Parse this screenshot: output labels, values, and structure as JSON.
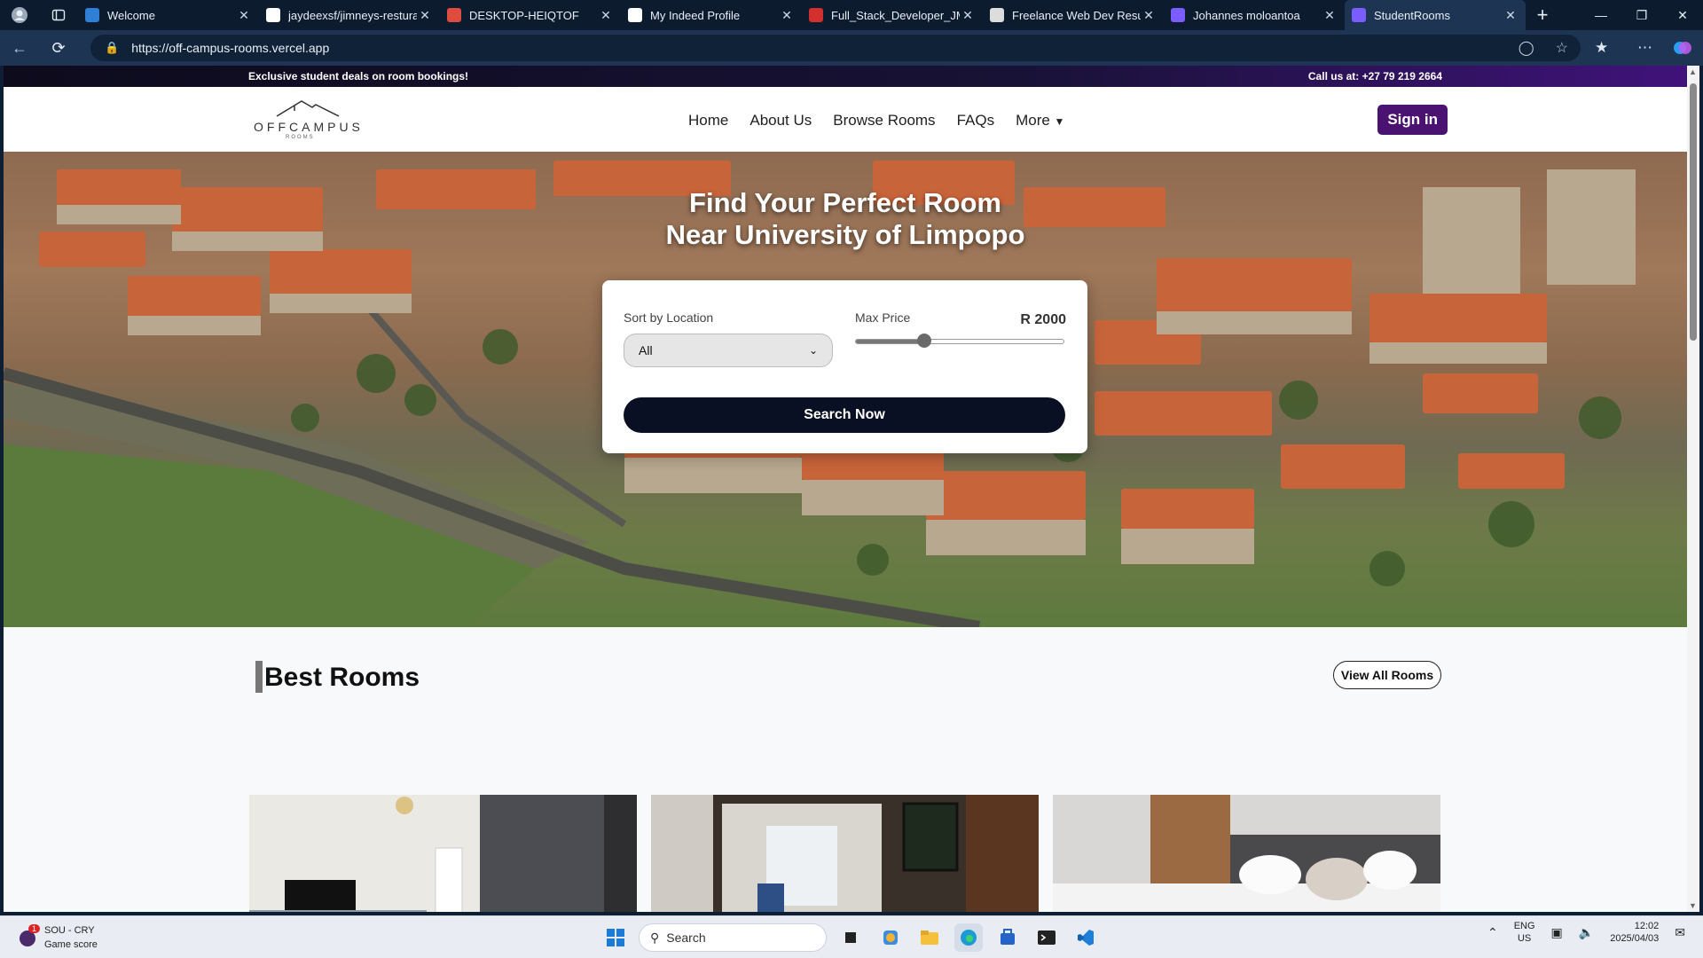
{
  "browser": {
    "tabs": [
      {
        "label": "Welcome",
        "color": "#2f7fd6"
      },
      {
        "label": "jaydeexsf/jimneys-resturant",
        "color": "#ffffff"
      },
      {
        "label": "DESKTOP-HEIQTOF",
        "color": "#e04b3f"
      },
      {
        "label": "My Indeed Profile",
        "color": "#ffffff"
      },
      {
        "label": "Full_Stack_Developer_JMC",
        "color": "#d32f2f"
      },
      {
        "label": "Freelance Web Dev Resume",
        "color": "#dddddd"
      },
      {
        "label": "Johannes moloantoa",
        "color": "#7b5cff"
      },
      {
        "label": "StudentRooms",
        "color": "#7b5cff"
      }
    ],
    "url": "https://off-campus-rooms.vercel.app"
  },
  "site": {
    "promo_left": "Exclusive student deals on room bookings!",
    "promo_right": "Call us at: +27 79 219 2664",
    "logo_word": "OFFCAMPUS",
    "logo_sub": "ROOMS",
    "nav": [
      "Home",
      "About Us",
      "Browse Rooms",
      "FAQs",
      "More"
    ],
    "more_icon": "caret-down-icon",
    "signin_label": "Sign in",
    "hero_title": "Find Your Perfect Room Near University of Limpopo",
    "search": {
      "location_label": "Sort by Location",
      "location_value": "All",
      "price_label": "Max Price",
      "price_value": "R 2000",
      "price_fraction": 0.33,
      "button_label": "Search Now"
    },
    "rooms_title": "Best Rooms",
    "view_all_label": "View All Rooms"
  },
  "taskbar": {
    "game_title": "SOU - CRY",
    "game_sub": "Game score",
    "game_badge": "1",
    "search_placeholder": "Search",
    "lang": "ENG",
    "region": "US",
    "time": "12:02",
    "date": "2025/04/03"
  },
  "colors": {
    "brand_purple": "#4a1271",
    "search_button": "#0a1023"
  }
}
